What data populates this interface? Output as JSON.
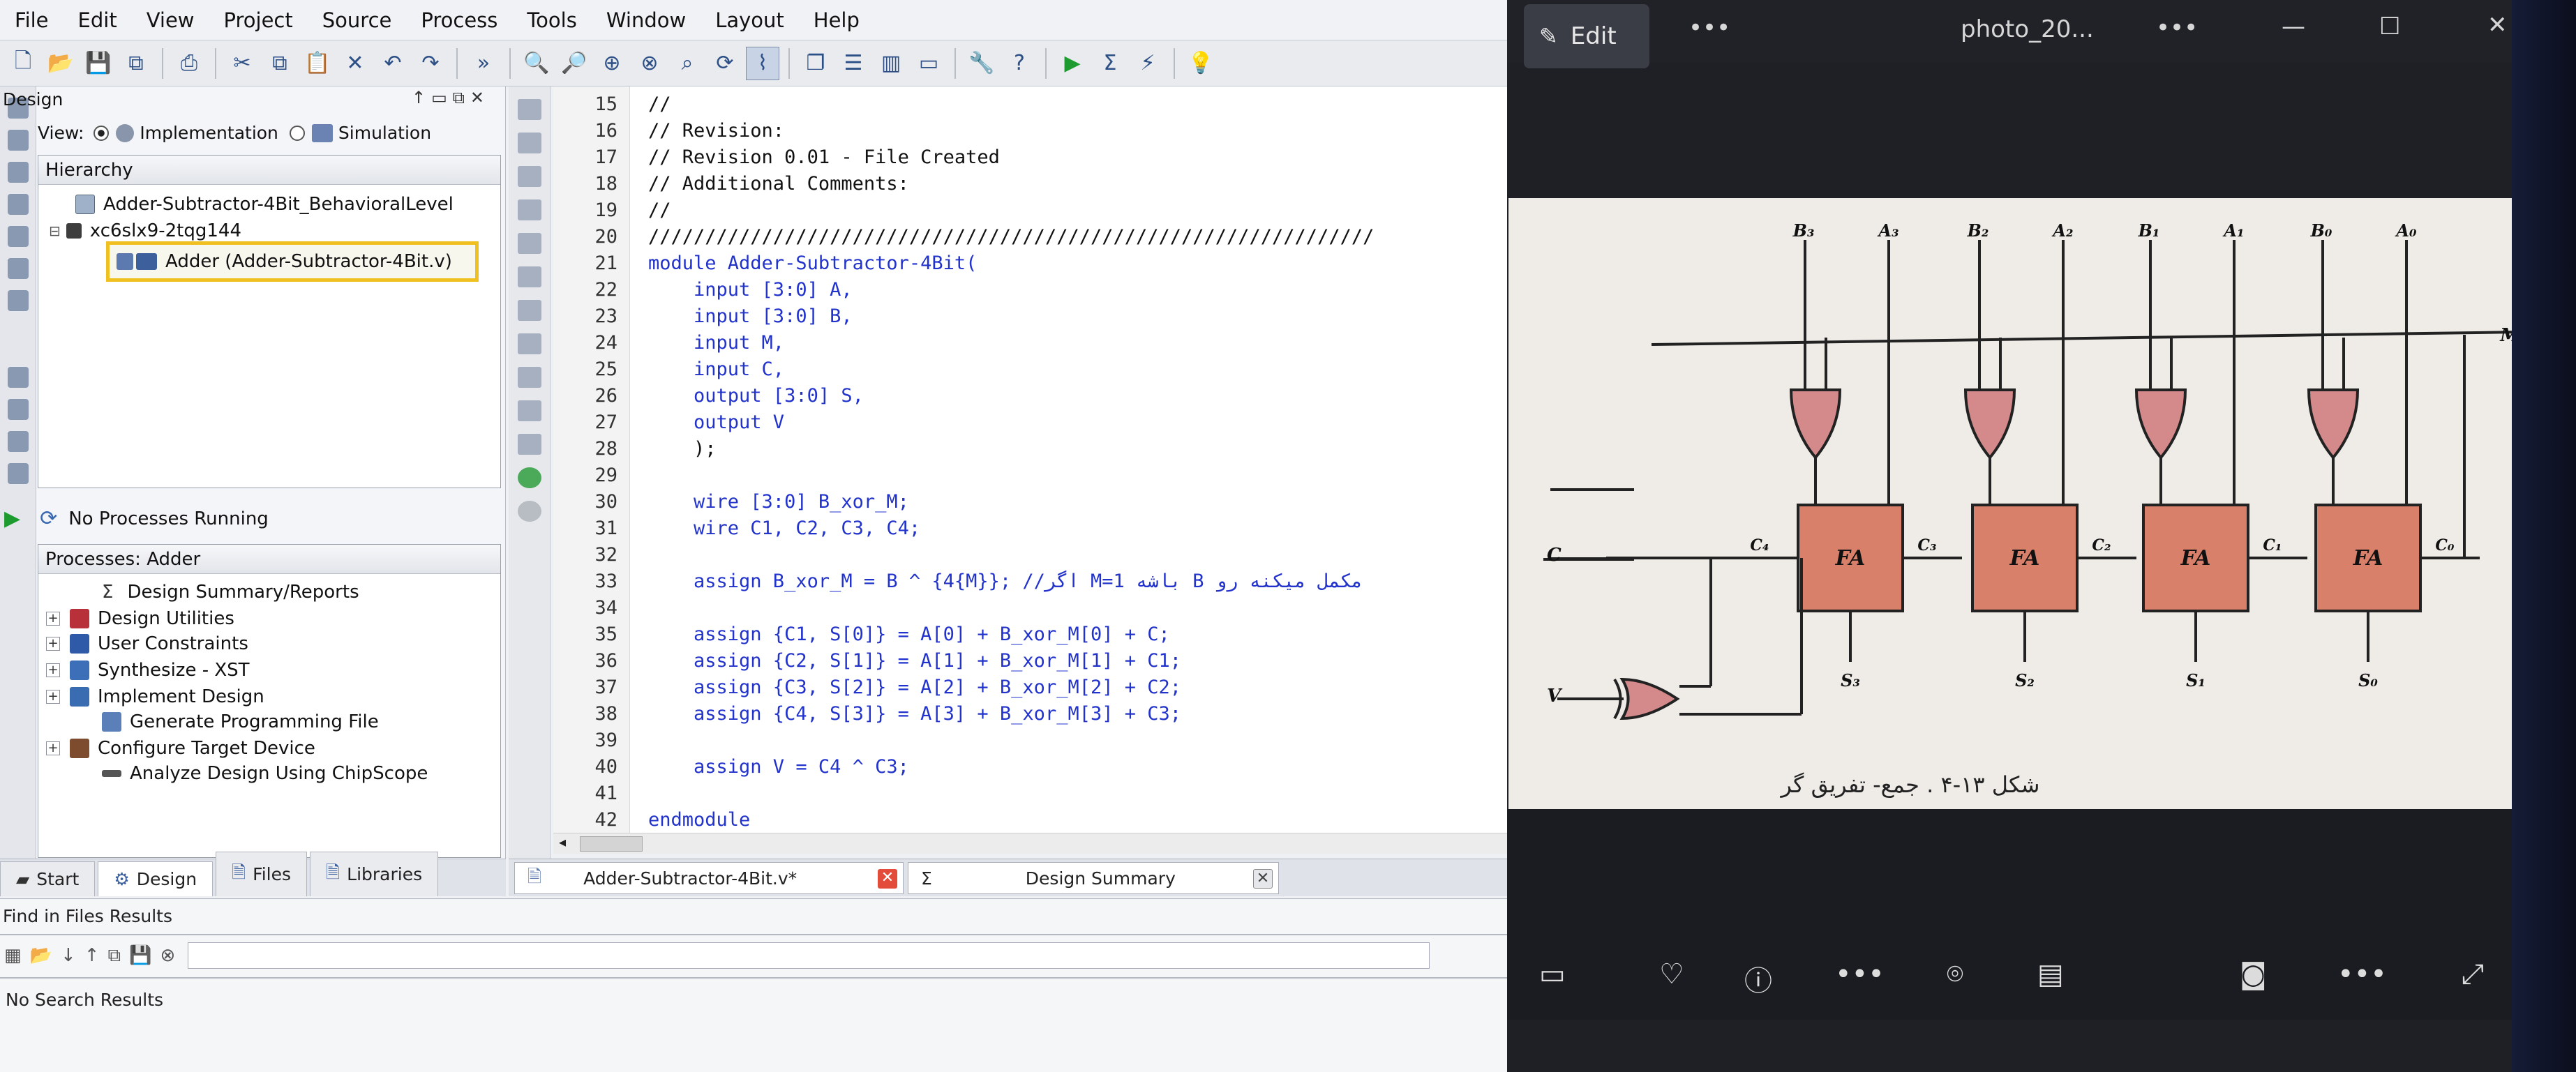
{
  "menu": [
    "File",
    "Edit",
    "View",
    "Project",
    "Source",
    "Process",
    "Tools",
    "Window",
    "Layout",
    "Help"
  ],
  "design_panel": {
    "title": "Design",
    "view_label": "View:",
    "impl_label": "Implementation",
    "sim_label": "Simulation",
    "hierarchy_label": "Hierarchy",
    "items": [
      "Adder-Subtractor-4Bit_BehavioralLevel",
      "xc6slx9-2tqg144",
      "Adder (Adder-Subtractor-4Bit.v)"
    ]
  },
  "process_status": "No Processes Running",
  "processes": {
    "title": "Processes: Adder",
    "items": [
      "Design Summary/Reports",
      "Design Utilities",
      "User Constraints",
      "Synthesize - XST",
      "Implement Design",
      "Generate Programming File",
      "Configure Target Device",
      "Analyze Design Using ChipScope"
    ]
  },
  "left_tabs": [
    "Start",
    "Design",
    "Files",
    "Libraries"
  ],
  "editor": {
    "lines": [
      {
        "n": "15",
        "t": "//"
      },
      {
        "n": "16",
        "t": "// Revision:"
      },
      {
        "n": "17",
        "t": "// Revision 0.01 - File Created"
      },
      {
        "n": "18",
        "t": "// Additional Comments:"
      },
      {
        "n": "19",
        "t": "//"
      },
      {
        "n": "20",
        "t": "////////////////////////////////////////////////////////////////"
      },
      {
        "n": "21",
        "t": "module Adder-Subtractor-4Bit("
      },
      {
        "n": "22",
        "t": "    input [3:0] A,"
      },
      {
        "n": "23",
        "t": "    input [3:0] B,"
      },
      {
        "n": "24",
        "t": "    input M,"
      },
      {
        "n": "25",
        "t": "    input C,"
      },
      {
        "n": "26",
        "t": "    output [3:0] S,"
      },
      {
        "n": "27",
        "t": "    output V"
      },
      {
        "n": "28",
        "t": "    );"
      },
      {
        "n": "29",
        "t": ""
      },
      {
        "n": "30",
        "t": "    wire [3:0] B_xor_M;"
      },
      {
        "n": "31",
        "t": "    wire C1, C2, C3, C4;"
      },
      {
        "n": "32",
        "t": ""
      },
      {
        "n": "33",
        "t": "    assign B_xor_M = B ^ {4{M}}; //اگر M=1 باشه B مکمل میکنه رو"
      },
      {
        "n": "34",
        "t": ""
      },
      {
        "n": "35",
        "t": "    assign {C1, S[0]} = A[0] + B_xor_M[0] + C;"
      },
      {
        "n": "36",
        "t": "    assign {C2, S[1]} = A[1] + B_xor_M[1] + C1;"
      },
      {
        "n": "37",
        "t": "    assign {C3, S[2]} = A[2] + B_xor_M[2] + C2;"
      },
      {
        "n": "38",
        "t": "    assign {C4, S[3]} = A[3] + B_xor_M[3] + C3;"
      },
      {
        "n": "39",
        "t": ""
      },
      {
        "n": "40",
        "t": "    assign V = C4 ^ C3;"
      },
      {
        "n": "41",
        "t": ""
      },
      {
        "n": "42",
        "t": "endmodule"
      }
    ]
  },
  "editor_tabs": [
    "Adder-Subtractor-4Bit.v*",
    "Design Summary"
  ],
  "find": {
    "title": "Find in Files Results",
    "result": "No Search Results"
  },
  "viewer": {
    "edit_label": "Edit",
    "filename": "photo_20...",
    "diagram": {
      "top_labels": [
        "B₃",
        "A₃",
        "B₂",
        "A₂",
        "B₁",
        "A₁",
        "B₀",
        "A₀"
      ],
      "fa_label": "FA",
      "carries": [
        "C₄",
        "C₃",
        "C₂",
        "C₁",
        "C₀"
      ],
      "sums": [
        "S₃",
        "S₂",
        "S₁",
        "S₀"
      ],
      "m_label": "M",
      "c_label": "C",
      "v_label": "V",
      "caption": "شکل ۱۳-۴ . جمع- تفریق گر"
    }
  },
  "colors": {
    "accent": "#f0c020",
    "xor_fill": "#d48a8a",
    "fa_fill": "#d9806a",
    "keyword": "#2233cc"
  }
}
